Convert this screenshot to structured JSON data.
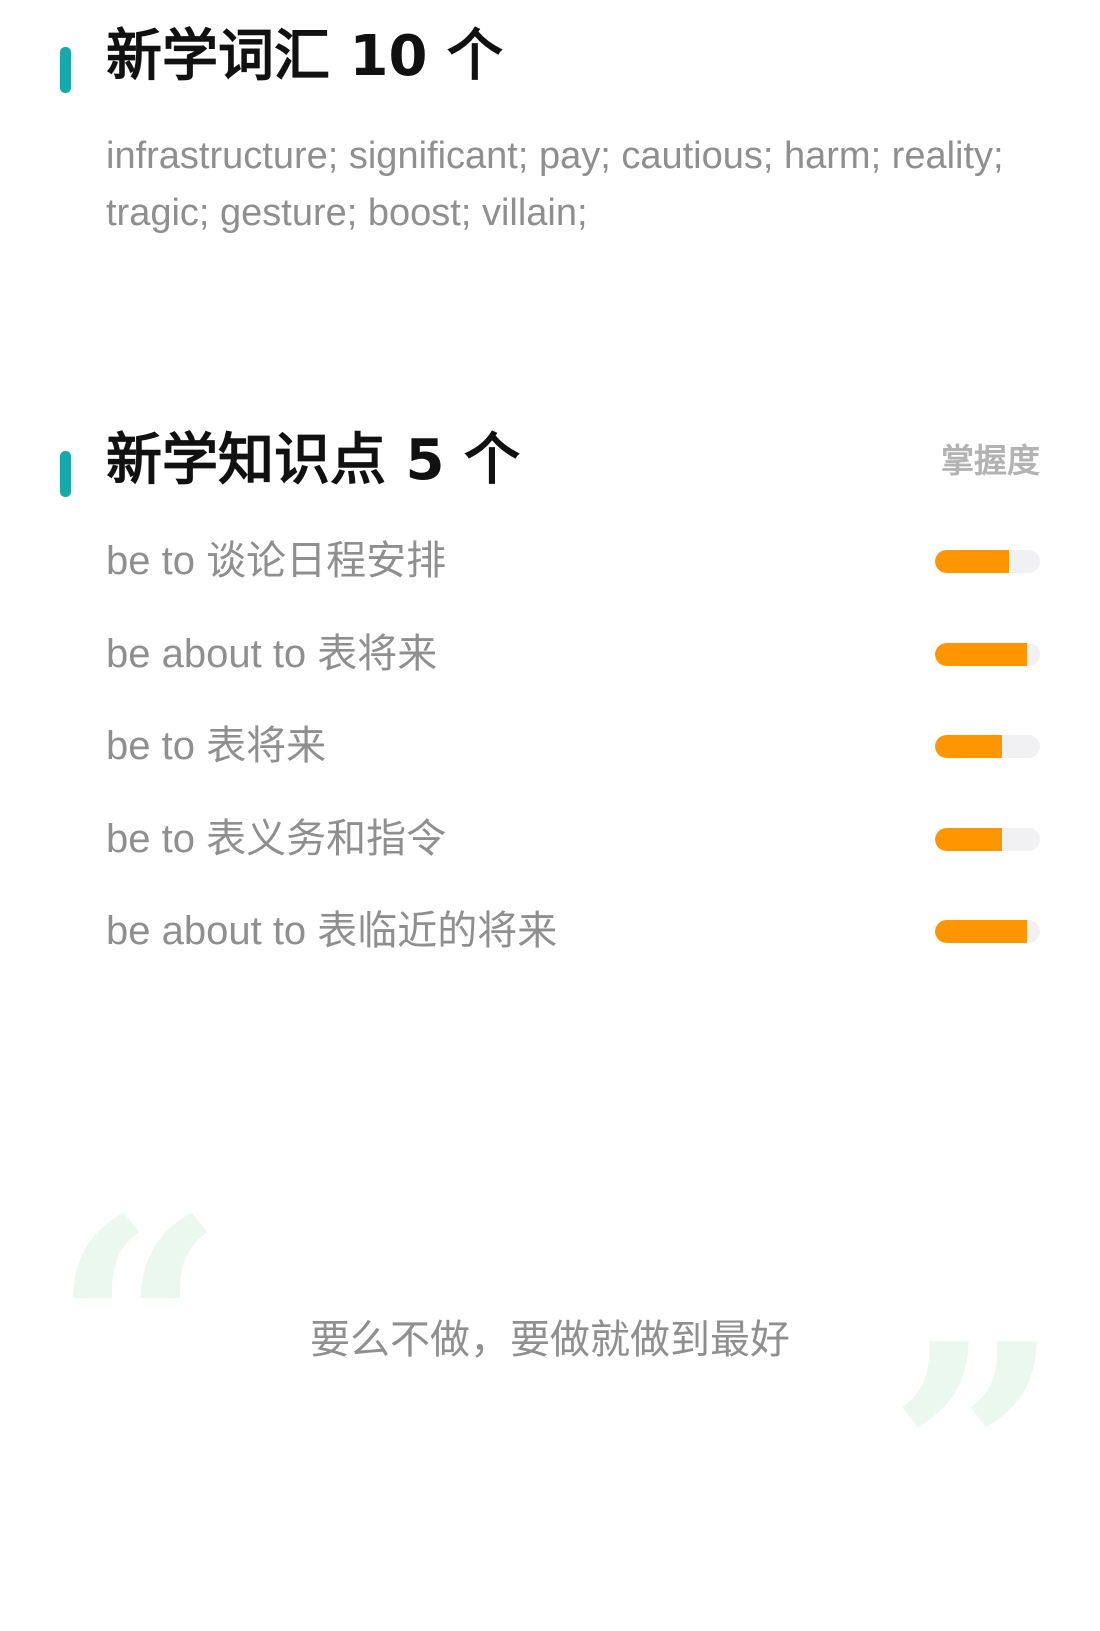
{
  "vocab_section": {
    "title": "新学词汇 10 个",
    "words_text": "infrastructure; significant; pay; cautious; harm; reality; tragic; gesture; boost; villain;"
  },
  "knowledge_section": {
    "title": "新学知识点 5 个",
    "mastery_label": "掌握度",
    "items": [
      {
        "label": "be to 谈论日程安排",
        "mastery": 0.7
      },
      {
        "label": "be about to 表将来",
        "mastery": 0.88
      },
      {
        "label": "be to 表将来",
        "mastery": 0.64
      },
      {
        "label": "be to 表义务和指令",
        "mastery": 0.64
      },
      {
        "label": "be about to 表临近的将来",
        "mastery": 0.88
      }
    ]
  },
  "footer": {
    "motto": "要么不做，要做就做到最好",
    "quote_open_glyph": "“",
    "quote_close_glyph": "”"
  },
  "colors": {
    "accent_bar": "#14a9ab",
    "progress_fill": "#ff9500",
    "progress_track": "#f1f1f4",
    "quote_mark": "#eaf8f0"
  }
}
